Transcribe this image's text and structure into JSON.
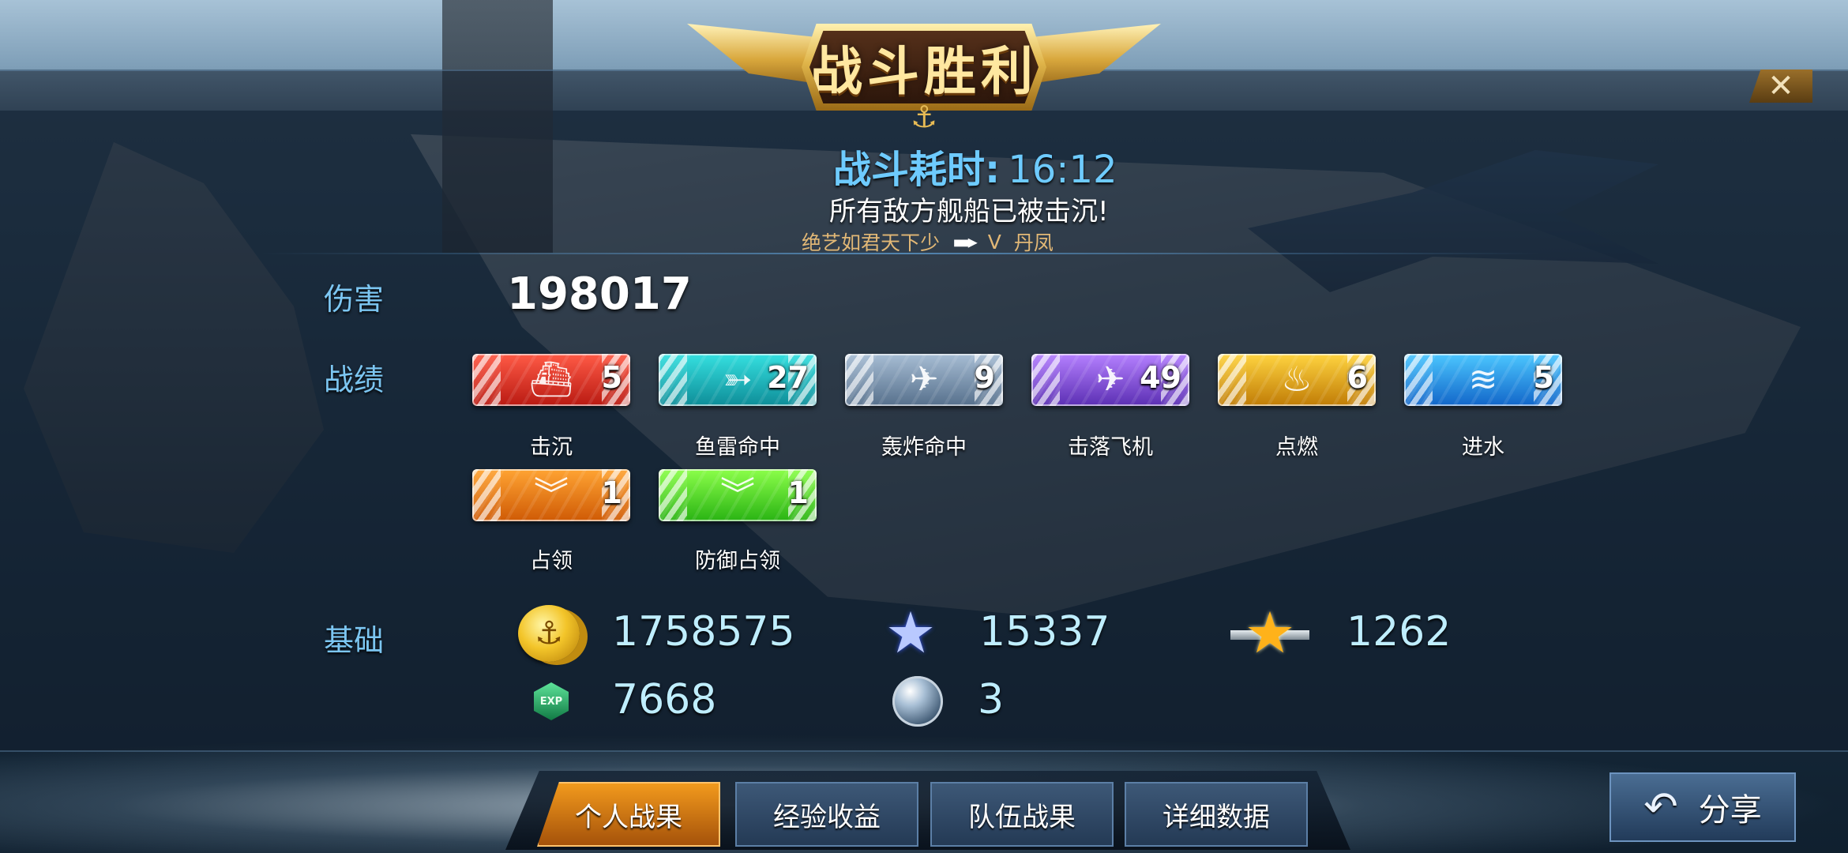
{
  "header": {
    "title": "战斗胜利",
    "close_label": "✕"
  },
  "summary": {
    "duration_label": "战斗耗时:",
    "duration_value": "16:12",
    "result_text": "所有敌方舰船已被击沉!",
    "player_name": "绝艺如君天下少",
    "player_rank": "V",
    "player_title": "丹凤"
  },
  "damage": {
    "label": "伤害",
    "value": "198017"
  },
  "achievements": {
    "label": "战绩",
    "items": [
      {
        "label": "击沉",
        "count": "5",
        "icon": "ship-sink-icon",
        "color": "#e33a2a"
      },
      {
        "label": "鱼雷命中",
        "count": "27",
        "icon": "torpedo-icon",
        "color": "#18b8c0"
      },
      {
        "label": "轰炸命中",
        "count": "9",
        "icon": "bomber-icon",
        "color": "#7f97b0"
      },
      {
        "label": "击落飞机",
        "count": "49",
        "icon": "plane-shotdown-icon",
        "color": "#8a52dd"
      },
      {
        "label": "点燃",
        "count": "6",
        "icon": "fire-icon",
        "color": "#e8a818"
      },
      {
        "label": "进水",
        "count": "5",
        "icon": "flooding-icon",
        "color": "#2b94ea"
      },
      {
        "label": "占领",
        "count": "1",
        "icon": "capture-icon",
        "color": "#f07a15"
      },
      {
        "label": "防御占领",
        "count": "1",
        "icon": "defend-capture-icon",
        "color": "#55dd2a"
      }
    ]
  },
  "base": {
    "label": "基础",
    "items": [
      {
        "icon": "gold-coin-icon",
        "value": "1758575"
      },
      {
        "icon": "blue-star-icon",
        "value": "15337"
      },
      {
        "icon": "rank-star-icon",
        "value": "1262"
      },
      {
        "icon": "exp-icon",
        "value": "7668",
        "icon_text": "EXP"
      },
      {
        "icon": "globe-icon",
        "value": "3"
      }
    ]
  },
  "tabs": [
    {
      "label": "个人战果",
      "active": true
    },
    {
      "label": "经验收益",
      "active": false
    },
    {
      "label": "队伍战果",
      "active": false
    },
    {
      "label": "详细数据",
      "active": false
    }
  ],
  "share": {
    "label": "分享"
  }
}
